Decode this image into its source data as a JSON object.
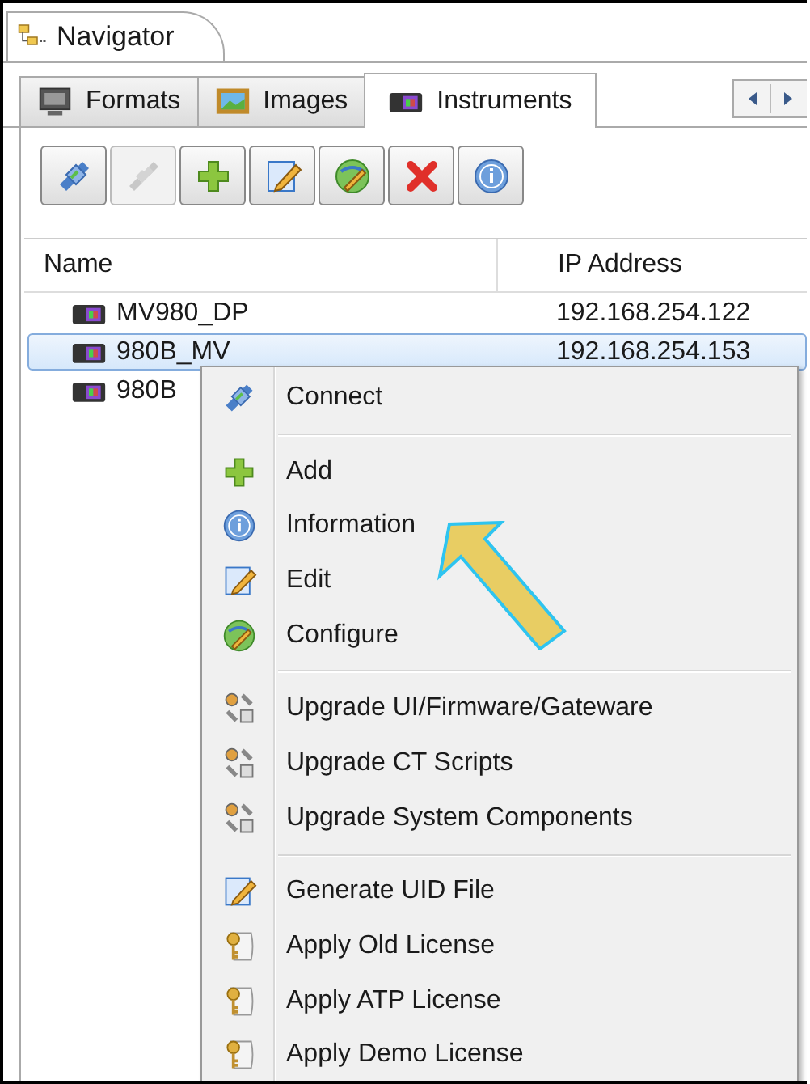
{
  "view_tab": {
    "title": "Navigator"
  },
  "tabs": [
    {
      "label": "Formats",
      "kind": "monitor",
      "selected": false
    },
    {
      "label": "Images",
      "kind": "image",
      "selected": false
    },
    {
      "label": "Instruments",
      "kind": "instrument",
      "selected": true
    }
  ],
  "toolbar": [
    {
      "kind": "connect",
      "disabled": false
    },
    {
      "kind": "disconnect",
      "disabled": true
    },
    {
      "kind": "add",
      "disabled": false
    },
    {
      "kind": "edit",
      "disabled": false
    },
    {
      "kind": "configure",
      "disabled": false
    },
    {
      "kind": "delete",
      "disabled": false
    },
    {
      "kind": "info",
      "disabled": false
    }
  ],
  "table": {
    "columns": [
      "Name",
      "IP Address"
    ],
    "rows": [
      {
        "name": "MV980_DP",
        "ip": "192.168.254.122",
        "selected": false
      },
      {
        "name": "980B_MV",
        "ip": "192.168.254.153",
        "selected": true
      },
      {
        "name": "980B",
        "selected": false
      }
    ]
  },
  "context_menu": [
    [
      {
        "label": "Connect",
        "kind": "connect"
      }
    ],
    [
      {
        "label": "Add",
        "kind": "add"
      },
      {
        "label": "Information",
        "kind": "info"
      },
      {
        "label": "Edit",
        "kind": "edit"
      },
      {
        "label": "Configure",
        "kind": "configure"
      }
    ],
    [
      {
        "label": "Upgrade UI/Firmware/Gateware",
        "kind": "tools"
      },
      {
        "label": "Upgrade CT Scripts",
        "kind": "tools"
      },
      {
        "label": "Upgrade System Components",
        "kind": "tools"
      }
    ],
    [
      {
        "label": "Generate UID File",
        "kind": "edit"
      },
      {
        "label": "Apply Old License",
        "kind": "key"
      },
      {
        "label": "Apply ATP License",
        "kind": "key"
      },
      {
        "label": "Apply Demo License",
        "kind": "key"
      }
    ]
  ]
}
